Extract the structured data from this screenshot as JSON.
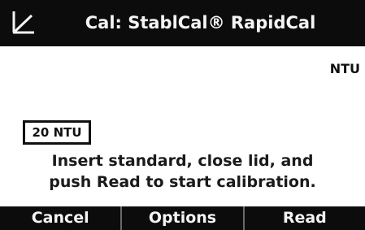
{
  "header": {
    "title": "Cal: StablCal® RapidCal",
    "icon": "calibration-checkmark-icon"
  },
  "reading": {
    "unit": "NTU"
  },
  "standard": {
    "value": "20 NTU"
  },
  "instructions": {
    "line1": "Insert standard, close lid, and",
    "line2": "push Read to start calibration."
  },
  "softkeys": {
    "cancel": "Cancel",
    "options": "Options",
    "read": "Read"
  },
  "colors": {
    "bar_background": "#0c0c0c",
    "bar_text": "#f4f4f4",
    "screen_background": "#ffffff"
  }
}
